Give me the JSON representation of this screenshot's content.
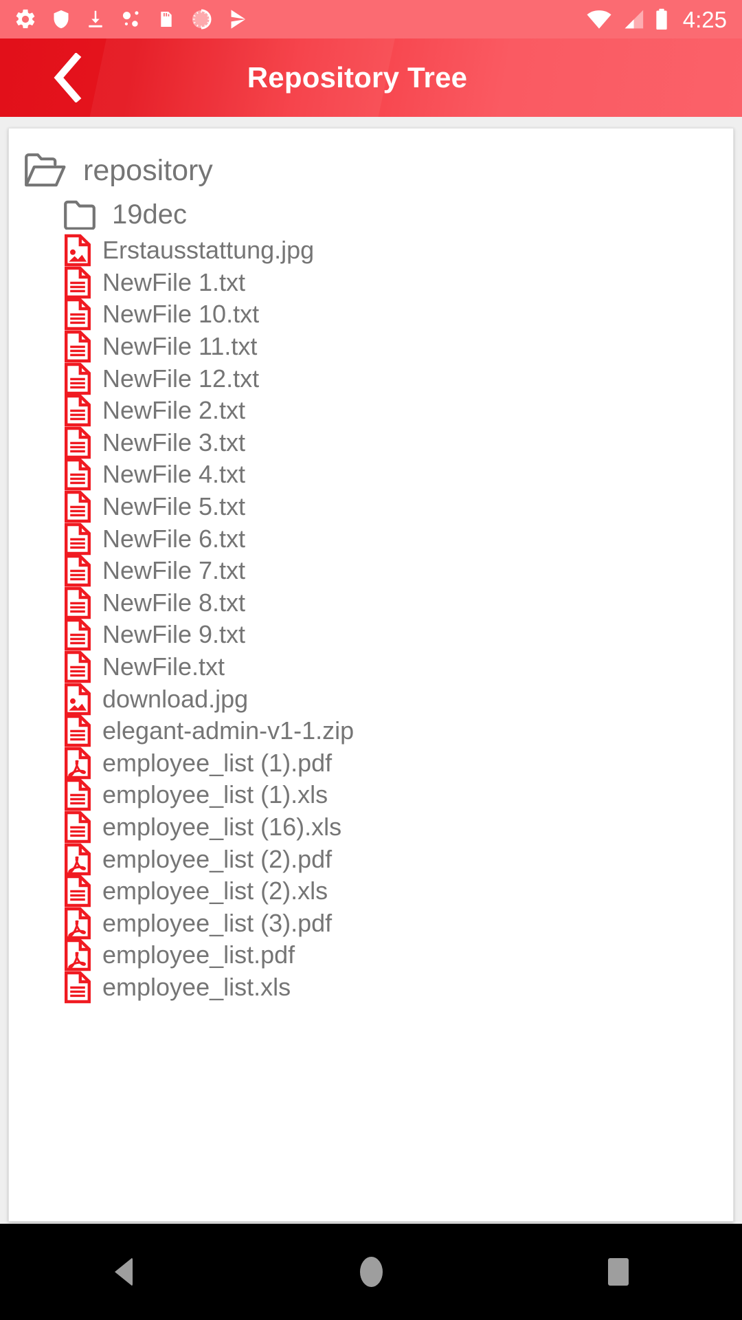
{
  "status_bar": {
    "background_color": "#FB6B72",
    "left_icons": [
      {
        "name": "settings-gear-icon"
      },
      {
        "name": "shield-icon"
      },
      {
        "name": "download-icon"
      },
      {
        "name": "dots-connection-icon"
      },
      {
        "name": "sd-card-icon"
      },
      {
        "name": "sync-circle-icon"
      },
      {
        "name": "play-arrow-icon"
      }
    ],
    "right_icons": [
      {
        "name": "wifi-icon"
      },
      {
        "name": "cellular-signal-icon"
      },
      {
        "name": "battery-icon"
      }
    ],
    "clock": "4:25"
  },
  "app_bar": {
    "title": "Repository Tree",
    "back_icon": "chevron-left-icon",
    "gradient_start_color": "#E2101A",
    "gradient_end_color": "#FB6169",
    "title_color": "#FFFFFF"
  },
  "tree": {
    "file_icon_color": "#F01A21",
    "folder_icon_color": "#757575",
    "label_color": "#757575",
    "nodes": [
      {
        "label": "repository",
        "level": 0,
        "type": "folder",
        "icon": "folder-open-icon",
        "expanded": true
      },
      {
        "label": "19dec",
        "level": 1,
        "type": "folder",
        "icon": "folder-closed-icon",
        "expanded": false
      },
      {
        "label": "Erstausstattung.jpg",
        "level": 2,
        "type": "file",
        "icon": "file-image-icon"
      },
      {
        "label": "NewFile 1.txt",
        "level": 2,
        "type": "file",
        "icon": "file-text-icon"
      },
      {
        "label": "NewFile 10.txt",
        "level": 2,
        "type": "file",
        "icon": "file-text-icon"
      },
      {
        "label": "NewFile 11.txt",
        "level": 2,
        "type": "file",
        "icon": "file-text-icon"
      },
      {
        "label": "NewFile 12.txt",
        "level": 2,
        "type": "file",
        "icon": "file-text-icon"
      },
      {
        "label": "NewFile 2.txt",
        "level": 2,
        "type": "file",
        "icon": "file-text-icon"
      },
      {
        "label": "NewFile 3.txt",
        "level": 2,
        "type": "file",
        "icon": "file-text-icon"
      },
      {
        "label": "NewFile 4.txt",
        "level": 2,
        "type": "file",
        "icon": "file-text-icon"
      },
      {
        "label": "NewFile 5.txt",
        "level": 2,
        "type": "file",
        "icon": "file-text-icon"
      },
      {
        "label": "NewFile 6.txt",
        "level": 2,
        "type": "file",
        "icon": "file-text-icon"
      },
      {
        "label": "NewFile 7.txt",
        "level": 2,
        "type": "file",
        "icon": "file-text-icon"
      },
      {
        "label": "NewFile 8.txt",
        "level": 2,
        "type": "file",
        "icon": "file-text-icon"
      },
      {
        "label": "NewFile 9.txt",
        "level": 2,
        "type": "file",
        "icon": "file-text-icon"
      },
      {
        "label": "NewFile.txt",
        "level": 2,
        "type": "file",
        "icon": "file-text-icon"
      },
      {
        "label": "download.jpg",
        "level": 2,
        "type": "file",
        "icon": "file-image-icon"
      },
      {
        "label": "elegant-admin-v1-1.zip",
        "level": 2,
        "type": "file",
        "icon": "file-text-icon"
      },
      {
        "label": "employee_list (1).pdf",
        "level": 2,
        "type": "file",
        "icon": "file-pdf-icon"
      },
      {
        "label": "employee_list (1).xls",
        "level": 2,
        "type": "file",
        "icon": "file-text-icon"
      },
      {
        "label": "employee_list (16).xls",
        "level": 2,
        "type": "file",
        "icon": "file-text-icon"
      },
      {
        "label": "employee_list (2).pdf",
        "level": 2,
        "type": "file",
        "icon": "file-pdf-icon"
      },
      {
        "label": "employee_list (2).xls",
        "level": 2,
        "type": "file",
        "icon": "file-text-icon"
      },
      {
        "label": "employee_list (3).pdf",
        "level": 2,
        "type": "file",
        "icon": "file-pdf-icon"
      },
      {
        "label": "employee_list.pdf",
        "level": 2,
        "type": "file",
        "icon": "file-pdf-icon"
      },
      {
        "label": "employee_list.xls",
        "level": 2,
        "type": "file",
        "icon": "file-text-icon"
      }
    ]
  },
  "nav_bar": {
    "background_color": "#000000",
    "buttons": [
      {
        "name": "nav-back-button",
        "icon": "triangle-back-icon"
      },
      {
        "name": "nav-home-button",
        "icon": "circle-home-icon"
      },
      {
        "name": "nav-recents-button",
        "icon": "square-recents-icon"
      }
    ]
  }
}
